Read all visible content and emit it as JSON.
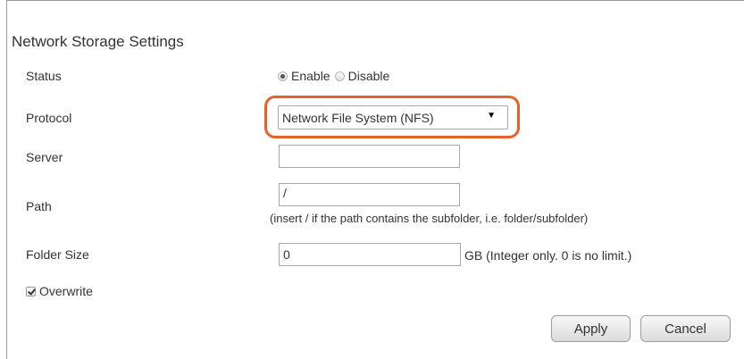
{
  "section": {
    "title": "Network Storage Settings"
  },
  "status": {
    "label": "Status",
    "options": [
      "Enable",
      "Disable"
    ],
    "selected": "Enable"
  },
  "protocol": {
    "label": "Protocol",
    "value": "Network File System (NFS)",
    "arrow": "▼"
  },
  "server": {
    "label": "Server",
    "value": ""
  },
  "path": {
    "label": "Path",
    "value": "/",
    "hint": "(insert / if the path contains the subfolder, i.e. folder/subfolder)"
  },
  "folder_size": {
    "label": "Folder Size",
    "value": "0",
    "unit_hint": "GB (Integer only. 0 is no limit.)"
  },
  "overwrite": {
    "label": "Overwrite",
    "checked": true
  },
  "buttons": {
    "apply": "Apply",
    "cancel": "Cancel"
  },
  "colors": {
    "highlight": "#e8602c"
  }
}
